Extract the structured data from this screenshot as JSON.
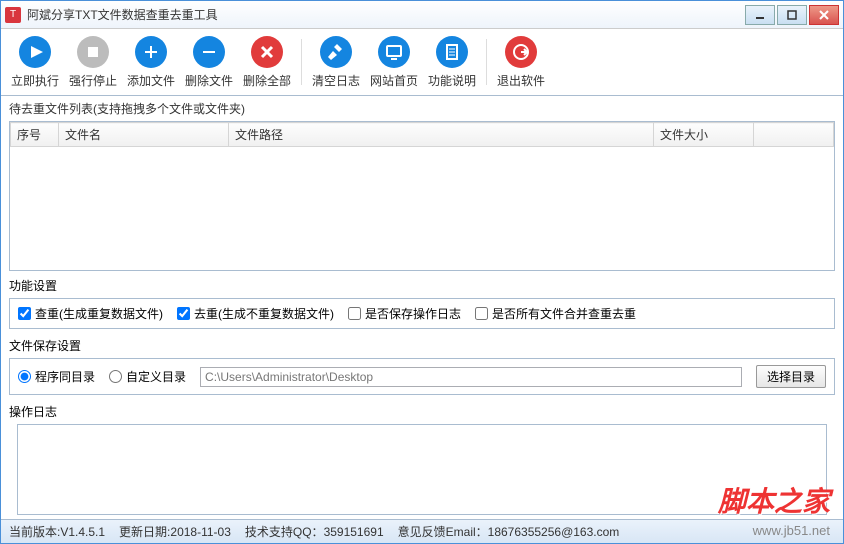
{
  "window": {
    "title": "阿斌分享TXT文件数据查重去重工具"
  },
  "toolbar": [
    {
      "label": "立即执行",
      "color": "#1485e0",
      "icon": "play"
    },
    {
      "label": "强行停止",
      "color": "#bcbcbc",
      "icon": "stop"
    },
    {
      "label": "添加文件",
      "color": "#1485e0",
      "icon": "plus"
    },
    {
      "label": "删除文件",
      "color": "#1485e0",
      "icon": "minus"
    },
    {
      "label": "删除全部",
      "color": "#e13b3b",
      "icon": "cross"
    },
    {
      "sep": true
    },
    {
      "label": "清空日志",
      "color": "#1485e0",
      "icon": "broom"
    },
    {
      "label": "网站首页",
      "color": "#1485e0",
      "icon": "monitor"
    },
    {
      "label": "功能说明",
      "color": "#1485e0",
      "icon": "doc"
    },
    {
      "sep": true
    },
    {
      "label": "退出软件",
      "color": "#e13b3b",
      "icon": "exit"
    }
  ],
  "file_list": {
    "header": "待去重文件列表(支持拖拽多个文件或文件夹)",
    "columns": [
      "序号",
      "文件名",
      "文件路径",
      "文件大小",
      ""
    ]
  },
  "func_settings": {
    "title": "功能设置",
    "checks": [
      {
        "label": "查重(生成重复数据文件)",
        "checked": true
      },
      {
        "label": "去重(生成不重复数据文件)",
        "checked": true
      },
      {
        "label": "是否保存操作日志",
        "checked": false
      },
      {
        "label": "是否所有文件合并查重去重",
        "checked": false
      }
    ]
  },
  "save_settings": {
    "title": "文件保存设置",
    "radios": [
      {
        "label": "程序同目录",
        "checked": true
      },
      {
        "label": "自定义目录",
        "checked": false
      }
    ],
    "path": "C:\\Users\\Administrator\\Desktop",
    "browse": "选择目录"
  },
  "log": {
    "title": "操作日志"
  },
  "status": {
    "version_label": "当前版本:",
    "version": "V1.4.5.1",
    "update_label": "更新日期:",
    "update": "2018-11-03",
    "qq_label": "技术支持QQ：",
    "qq": "359151691",
    "email_label": "意见反馈Email：",
    "email": "18676355256@163.com"
  },
  "watermark": {
    "text": "脚本之家",
    "url": "www.jb51.net"
  }
}
